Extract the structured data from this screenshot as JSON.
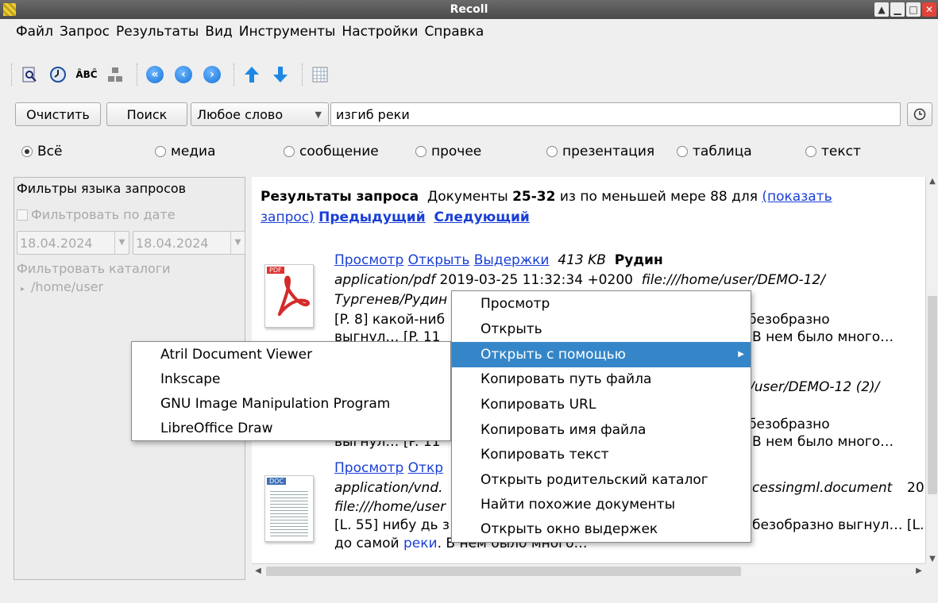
{
  "window": {
    "title": "Recoll"
  },
  "menubar": [
    "Файл",
    "Запрос",
    "Результаты",
    "Вид",
    "Инструменты",
    "Настройки",
    "Справка"
  ],
  "toolbar": {
    "icons": [
      "query-window-icon",
      "history-icon",
      "spelling-icon",
      "similar-docs-icon",
      "first-page-icon",
      "previous-page-icon",
      "next-page-icon",
      "sort-ascending-icon",
      "sort-descending-icon",
      "table-view-icon"
    ]
  },
  "search": {
    "clear_label": "Очистить",
    "search_label": "Поиск",
    "mode": "Любое слово",
    "query": "изгиб реки"
  },
  "categories": [
    {
      "label": "Всё",
      "selected": true
    },
    {
      "label": "медиа",
      "selected": false
    },
    {
      "label": "сообщение",
      "selected": false
    },
    {
      "label": "прочее",
      "selected": false
    },
    {
      "label": "презентация",
      "selected": false
    },
    {
      "label": "таблица",
      "selected": false
    },
    {
      "label": "текст",
      "selected": false
    }
  ],
  "filters": {
    "title": "Фильтры языка запросов",
    "date_label": "Фильтровать по дате",
    "date_from": "18.04.2024",
    "date_to": "18.04.2024",
    "dirs_label": "Фильтровать каталоги",
    "dir_item": "/home/user"
  },
  "results": {
    "header_bold": "Результаты запроса",
    "header_pre": "Документы",
    "range": "25-32",
    "header_post": "из по меньшей мере 88 для",
    "show_query_1": "(показать",
    "show_query_2": "запрос)",
    "prev": "Предыдущий",
    "next": "Следующий",
    "items": [
      {
        "preview": "Просмотр",
        "open": "Открыть",
        "snippets": "Выдержки",
        "size": "413 KB",
        "title": "Рудин",
        "meta_mime": "application/pdf",
        "meta_date": "2019-03-25 11:32:34 +0200",
        "meta_url": "file:///home/user/DEMO-12/",
        "path2": "Тургенев/Рудин",
        "snip1": "[P. 8] какой-ниб",
        "snip1_right": "безобразно",
        "snip2": "выгнул… [P. 11",
        "snip2_right": "В нем было много…"
      },
      {
        "url_right": "/user/DEMO-12 (2)/",
        "snip1_right": "безобразно",
        "snip2_left": "выгнул… [P. 11",
        "snip2_right": "В нем было много…"
      },
      {
        "preview": "Просмотр",
        "open": "Откр",
        "meta_mime": "application/vnd.",
        "meta_mime_right": "cessingml.document",
        "meta_tail": "20",
        "url": "file:///home/user",
        "snip1": "[L. 55] нибу дь з",
        "snip1_right": "безобразно выгнул… [L.",
        "snip2_pre": "до самой",
        "snip2_hl": "реки",
        "snip2_post": ". В нем было много…"
      }
    ]
  },
  "context_menu": {
    "items": [
      "Просмотр",
      "Открыть",
      "Открыть с помощью",
      "Копировать путь файла",
      "Копировать URL",
      "Копировать имя файла",
      "Копировать текст",
      "Открыть родительский каталог",
      "Найти похожие документы",
      "Открыть окно выдержек"
    ],
    "selected_index": 2
  },
  "open_with_menu": {
    "items": [
      "Atril Document Viewer",
      "Inkscape",
      "GNU Image Manipulation Program",
      "LibreOffice Draw"
    ]
  },
  "colors": {
    "link": "#1a3fd6",
    "menu_highlight": "#3586c9",
    "titlebar": "#555555"
  }
}
